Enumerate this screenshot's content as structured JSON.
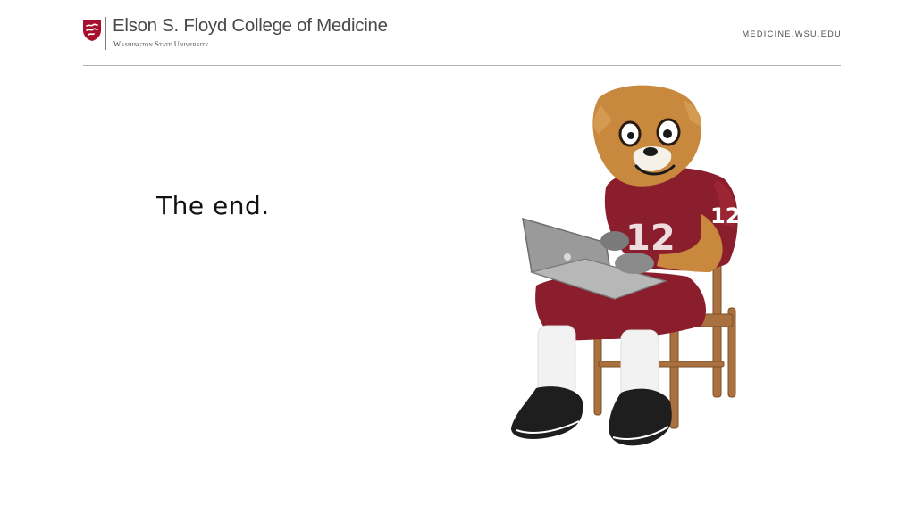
{
  "header": {
    "college_name": "Elson S. Floyd College of Medicine",
    "university_name": "Washington State University",
    "site_url": "MEDICINE.WSU.EDU",
    "brand_color": "#a60f2d"
  },
  "slide": {
    "body_text": "The end."
  },
  "mascot": {
    "jersey_number": "12",
    "jersey_color": "#8b1e2c",
    "fur_color": "#c8893e"
  }
}
